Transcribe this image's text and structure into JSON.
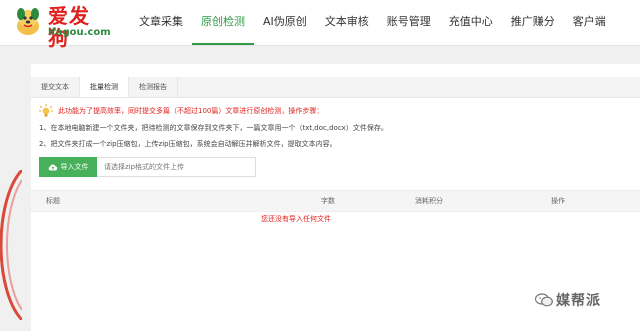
{
  "brand": {
    "name": "爱发狗",
    "domain": "ifagou.com"
  },
  "nav": [
    {
      "label": "文章采集"
    },
    {
      "label": "原创检测",
      "active": true
    },
    {
      "label": "AI伪原创"
    },
    {
      "label": "文本审核"
    },
    {
      "label": "账号管理"
    },
    {
      "label": "充值中心"
    },
    {
      "label": "推广赚分"
    },
    {
      "label": "客户端"
    }
  ],
  "tabs": [
    {
      "label": "提交文本"
    },
    {
      "label": "批量检测",
      "active": true
    },
    {
      "label": "检测报告"
    }
  ],
  "notice": "此功能为了提高效率，同时提交多篇（不超过100篇）文章进行原创检测，操作步骤：",
  "steps": [
    "1、在本地电脑新建一个文件夹，把待检测的文章保存到文件夹下，一篇文章用一个（txt,doc,docx）文件保存。",
    "2、把文件夹打成一个zip压缩包，上传zip压缩包，系统会自动解压并解析文件，提取文本内容。"
  ],
  "upload": {
    "button_label": "导入文件",
    "placeholder": "请选择zip格式的文件上传"
  },
  "table": {
    "columns": [
      "标题",
      "字数",
      "消耗积分",
      "操作"
    ],
    "empty_text": "您还没有导入任何文件"
  },
  "watermark": "媒帮派",
  "colors": {
    "accent": "#2e9a45",
    "warning": "#e0201c",
    "button": "#47b05a"
  }
}
